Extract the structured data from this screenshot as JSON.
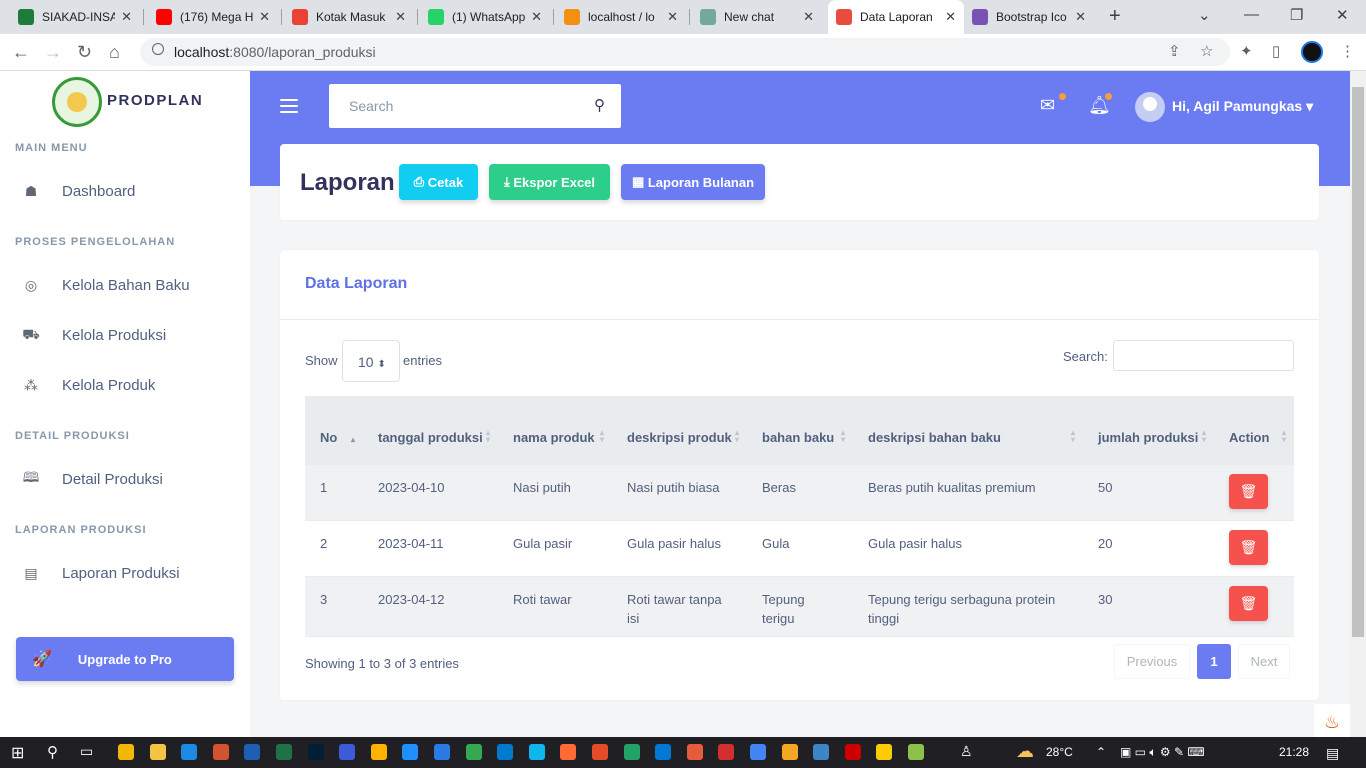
{
  "browser": {
    "tabs": [
      {
        "title": "SIAKAD-INSAN",
        "color": "#1e7c3a",
        "active": false
      },
      {
        "title": "(176) Mega H",
        "color": "#ff0000",
        "active": false
      },
      {
        "title": "Kotak Masuk",
        "color": "#ea4335",
        "active": false
      },
      {
        "title": "(1) WhatsApp",
        "color": "#25d366",
        "active": false
      },
      {
        "title": "localhost / lo",
        "color": "#f29111",
        "active": false
      },
      {
        "title": "New chat",
        "color": "#74aa9c",
        "active": false
      },
      {
        "title": "Data Laporan",
        "color": "#e74c3c",
        "active": true
      },
      {
        "title": "Bootstrap Ico",
        "color": "#7952b3",
        "active": false
      }
    ],
    "url_host": "localhost",
    "url_path": ":8080/laporan_produksi"
  },
  "sidebar": {
    "brand": "PRODPLAN",
    "sections": {
      "main": "MAIN MENU",
      "proses": "PROSES PENGELOLAHAN",
      "detail": "DETAIL PRODUKSI",
      "laporan": "LAPORAN PRODUKSI"
    },
    "items": {
      "dashboard": "Dashboard",
      "bahan_baku": "Kelola Bahan Baku",
      "produksi": "Kelola Produksi",
      "produk": "Kelola Produk",
      "detail": "Detail Produksi",
      "laporan": "Laporan Produksi"
    },
    "upgrade": "Upgrade to Pro"
  },
  "header": {
    "search_placeholder": "Search",
    "user": "Hi, Agil Pamungkas"
  },
  "report": {
    "title": "Laporan",
    "btn_print": "Cetak",
    "btn_excel": "Ekspor Excel",
    "btn_monthly": "Laporan Bulanan"
  },
  "data_card": {
    "title": "Data Laporan",
    "show": "Show",
    "entries_value": "10",
    "entries": "entries",
    "search_label": "Search:",
    "columns": [
      "No",
      "tanggal produksi",
      "nama produk",
      "deskripsi produk",
      "bahan baku",
      "deskripsi bahan baku",
      "jumlah produksi",
      "Action"
    ],
    "rows": [
      {
        "no": "1",
        "tanggal": "2023-04-10",
        "nama": "Nasi putih",
        "deskripsi": "Nasi putih biasa",
        "bahan": "Beras",
        "desk_bahan": "Beras putih kualitas premium",
        "jumlah": "50"
      },
      {
        "no": "2",
        "tanggal": "2023-04-11",
        "nama": "Gula pasir",
        "deskripsi": "Gula pasir halus",
        "bahan": "Gula",
        "desk_bahan": "Gula pasir halus",
        "jumlah": "20"
      },
      {
        "no": "3",
        "tanggal": "2023-04-12",
        "nama": "Roti tawar",
        "deskripsi": "Roti tawar tanpa isi",
        "bahan": "Tepung terigu",
        "desk_bahan": "Tepung terigu serbaguna protein tinggi",
        "jumlah": "30"
      }
    ],
    "info": "Showing 1 to 3 of 3 entries",
    "prev": "Previous",
    "page": "1",
    "next": "Next"
  },
  "taskbar": {
    "weather": "28°C",
    "time": "21:28"
  },
  "colors": {
    "primary": "#6b7cf3",
    "info": "#11cdef",
    "success": "#2dce89",
    "danger": "#f5524d"
  }
}
